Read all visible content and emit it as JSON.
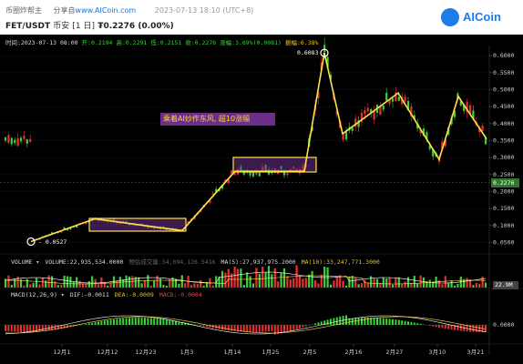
{
  "header": {
    "site": "币圈炸帮主",
    "share_label": "分享自",
    "share_link": "www.AICoin.com",
    "datetime": "2023-07-13 18:10 (UTC+8)",
    "pair": "FET/USDT",
    "market": "币安",
    "timeframe": "[1 日]",
    "price_symbol": "₮0.2276",
    "change": "(0.00%)",
    "logo_text": "AICoin"
  },
  "ohlc": {
    "time": "时间:2023-07-13 08:00",
    "open": "开:0.2194",
    "high": "高:0.2291",
    "low": "低:0.2151",
    "close": "收:0.2276",
    "change": "涨幅:3.69%(0.0081)",
    "amplitude": "振幅:6.38%"
  },
  "annotation": "乘着AI炒作东风, 超10涨幅",
  "price_tag": "0.2276",
  "high_label": "0.6083 -",
  "low_label": "- 0.0527",
  "volume": {
    "title": "VOLUME ▾",
    "volume": "VOLUME:22,935,534.0000",
    "forecast": "预估成交量:54,094,126.5416",
    "ma5": "MA(5):27,937,975.2000",
    "ma10": "MA(10):33,247,771.3000",
    "tag": "22.9M"
  },
  "macd": {
    "title": "MACD(12,26,9) ▾",
    "dif": "DIF:-0.0011",
    "dea": "DEA:-0.0009",
    "macd": "MACD:-0.0004",
    "axis_label": "0.0000"
  },
  "price_axis": [
    "0.6000",
    "0.5500",
    "0.5000",
    "0.4500",
    "0.4000",
    "0.3500",
    "0.3000",
    "0.2500",
    "0.2000",
    "0.1500",
    "0.1000",
    "0.0500"
  ],
  "x_axis": [
    "12月1",
    "12月12",
    "12月23",
    "1月3",
    "1月14",
    "1月25",
    "2月5",
    "2月16",
    "2月27",
    "3月10",
    "3月21"
  ],
  "colors": {
    "up": "#3ad13a",
    "down": "#e83030",
    "annotation_line": "#ffe14a",
    "box_border": "#ffe14a",
    "box_fill": "#6b2f8a"
  },
  "chart_data": {
    "type": "candlestick",
    "y_range": [
      0.03,
      0.63
    ],
    "pattern_points": [
      {
        "date": "12月1",
        "price": 0.0527
      },
      {
        "date": "12月12",
        "price": 0.12
      },
      {
        "date": "1月3",
        "price": 0.085
      },
      {
        "date": "1月14",
        "price": 0.26
      },
      {
        "date": "2月2",
        "price": 0.26
      },
      {
        "date": "2月5",
        "price": 0.6083
      },
      {
        "date": "2月11",
        "price": 0.37
      },
      {
        "date": "2月24",
        "price": 0.49
      },
      {
        "date": "3月10",
        "price": 0.295
      },
      {
        "date": "3月16",
        "price": 0.48
      },
      {
        "date": "3月26",
        "price": 0.355
      }
    ]
  }
}
